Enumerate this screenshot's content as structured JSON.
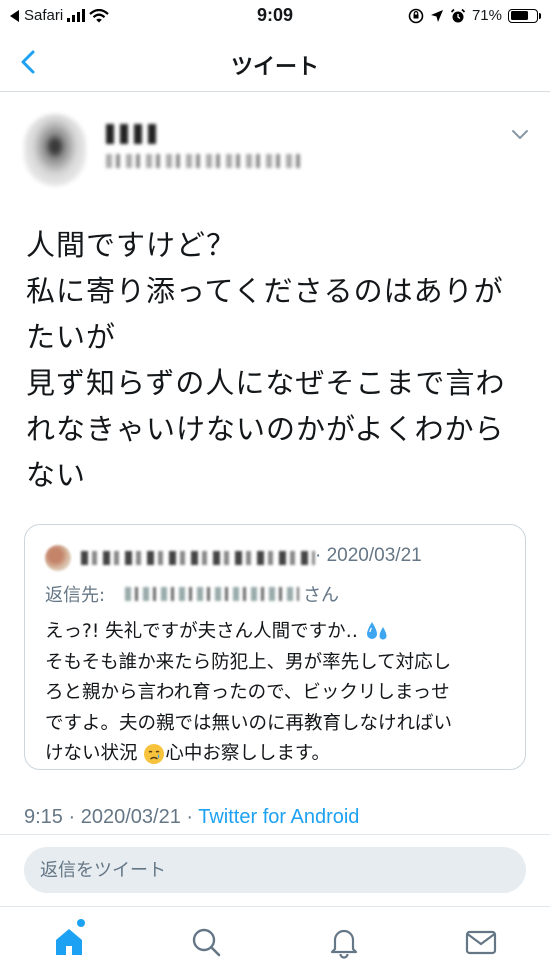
{
  "status_bar": {
    "carrier": "Safari",
    "time": "9:09",
    "battery": "71%",
    "battery_level": 0.71
  },
  "header": {
    "title": "ツイート"
  },
  "tweet": {
    "lines": [
      "人間ですけど？",
      "私に寄り添ってくださるのはありが",
      "たいが",
      "見ず知らずの人になぜそこまで言わ",
      "れなきゃいけないのかがよくわから",
      "ない"
    ],
    "time": "9:15",
    "date": "2020/03/21",
    "source": "Twitter for Android"
  },
  "quote": {
    "date": "· 2020/03/21",
    "reply_label": "返信先: ",
    "reply_suffix": "さん",
    "lines": [
      "えっ?! 失礼ですが夫さん人間ですか‥",
      "そもそも誰か来たら防犯上、男が率先して対応し",
      "ろと親から言われ育ったので、ビックリしまっせ",
      "ですよ。夫の親では無いのに再教育しなければい",
      "けない状況",
      "心中お察しします。"
    ]
  },
  "reply_bar": {
    "placeholder": "返信をツイート"
  },
  "colors": {
    "accent": "#1da1f2",
    "secondary_text": "#657786",
    "text": "#14171a"
  },
  "icons": {
    "back": "chevron-left-icon",
    "more": "chevron-down-icon",
    "home": "home-icon",
    "search": "search-icon",
    "notifications": "bell-icon",
    "messages": "mail-icon"
  }
}
